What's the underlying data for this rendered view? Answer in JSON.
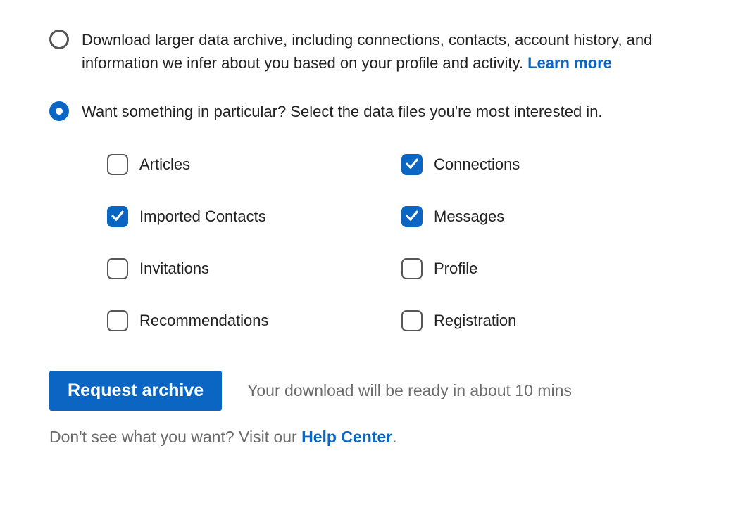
{
  "colors": {
    "accent": "#0a66c2",
    "text_dark": "#222222",
    "text_muted": "#6b6b6b"
  },
  "radios": [
    {
      "id": "larger-archive",
      "selected": false,
      "label_prefix": "Download larger data archive, including connections, contacts, account history, and information we infer about you based on your profile and activity. ",
      "link_text": "Learn more"
    },
    {
      "id": "specific-files",
      "selected": true,
      "label": "Want something in particular? Select the data files you're most interested in.",
      "link_text": ""
    }
  ],
  "checkboxes": [
    {
      "id": "articles",
      "label": "Articles",
      "checked": false
    },
    {
      "id": "connections",
      "label": "Connections",
      "checked": true
    },
    {
      "id": "imported-contacts",
      "label": "Imported Contacts",
      "checked": true
    },
    {
      "id": "messages",
      "label": "Messages",
      "checked": true
    },
    {
      "id": "invitations",
      "label": "Invitations",
      "checked": false
    },
    {
      "id": "profile",
      "label": "Profile",
      "checked": false
    },
    {
      "id": "recommendations",
      "label": "Recommendations",
      "checked": false
    },
    {
      "id": "registration",
      "label": "Registration",
      "checked": false
    }
  ],
  "action": {
    "button_label": "Request archive",
    "status_text": "Your download will be ready in about 10 mins"
  },
  "help": {
    "prefix": "Don't see what you want? Visit our ",
    "link_text": "Help Center",
    "suffix": "."
  }
}
